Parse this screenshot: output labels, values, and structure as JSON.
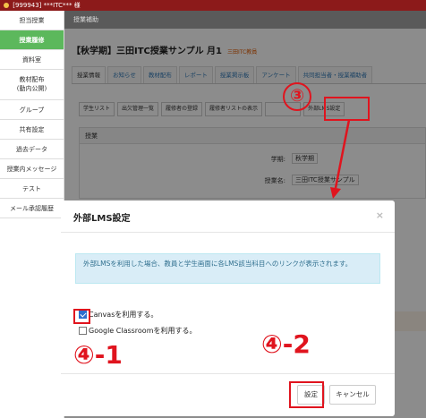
{
  "topbar": {
    "user_text": "[999943] ***ITC*** 様"
  },
  "sidebar": {
    "items": [
      {
        "label": "担当授業"
      },
      {
        "label": "授業履修"
      },
      {
        "label": "資料室"
      },
      {
        "label": "教材配布\n(動内公開)"
      },
      {
        "label": "グループ"
      },
      {
        "label": "共有設定"
      },
      {
        "label": "過去データ"
      },
      {
        "label": "授業内メッセージ"
      },
      {
        "label": "テスト"
      },
      {
        "label": "メール承認履歴"
      }
    ]
  },
  "band": {
    "label": "授業補助"
  },
  "course": {
    "title": "【秋学期】三田ITC授業サンプル 月1",
    "teacher": "三田ITC教員"
  },
  "tabs": [
    "授業情報",
    "お知らせ",
    "教材配布",
    "レポート",
    "授業掲示板",
    "アンケート",
    "共同担当者・授業補助者"
  ],
  "subtabs": [
    "学生リスト",
    "出欠管理一覧",
    "履修者の登録",
    "履修者リストの表示",
    "",
    "外部LMS設定"
  ],
  "panel": {
    "heading": "授業",
    "rows": [
      {
        "label": "学期:",
        "value": "秋学期"
      },
      {
        "label": "授業名:",
        "value": "三田ITC授業サンプル"
      }
    ]
  },
  "modal": {
    "title": "外部LMS設定",
    "close": "×",
    "info": "外部LMSを利用した場合、教員と学生画面に各LMS該当科目へのリンクが表示されます。",
    "options": [
      {
        "label": "Canvasを利用する。",
        "checked": true
      },
      {
        "label": "Google Classroomを利用する。",
        "checked": false
      }
    ],
    "save_label": "設定",
    "cancel_label": "キャンセル"
  },
  "annotations": {
    "step3": "③",
    "step4_1": "④-1",
    "step4_2": "④-2",
    "color": "#e0141e"
  },
  "colors": {
    "accent_green": "#5cb85c",
    "topbar": "#8c1a1a",
    "highlight_red": "#e0141e",
    "checkbox_blue": "#2d6fcf"
  }
}
